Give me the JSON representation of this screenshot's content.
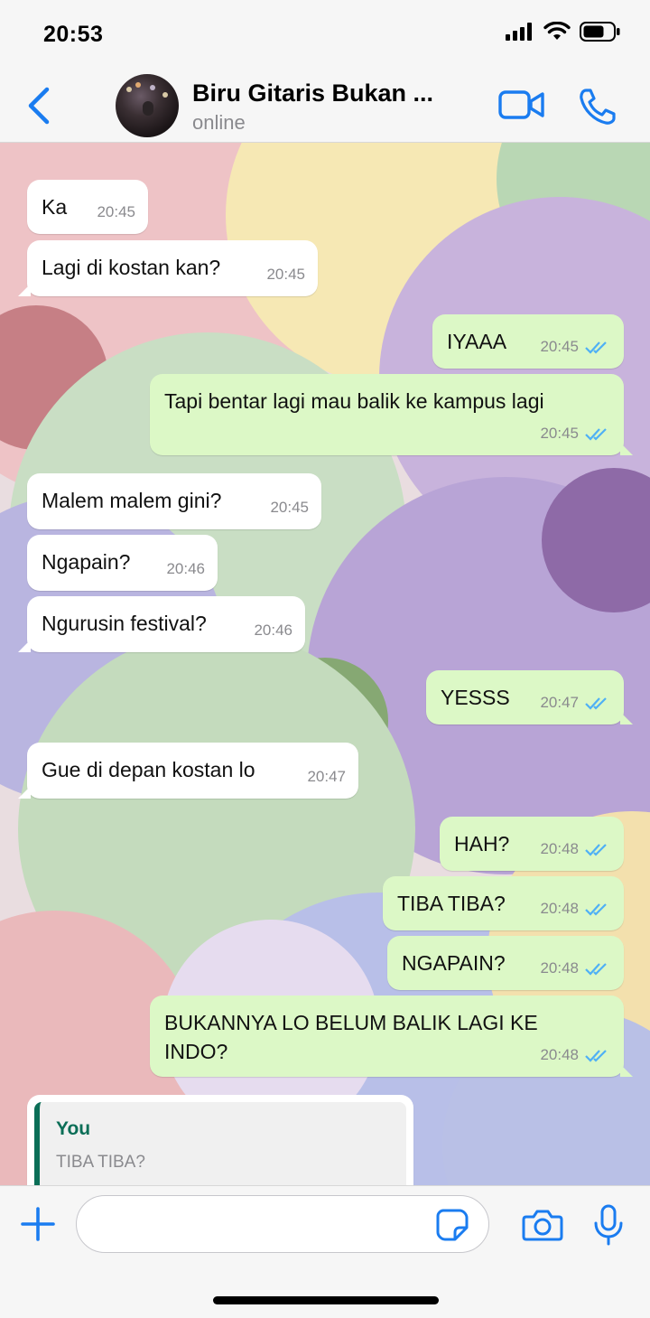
{
  "status_bar": {
    "time": "20:53"
  },
  "header": {
    "contact_name": "Biru Gitaris Bukan ...",
    "status": "online"
  },
  "messages": [
    {
      "dir": "in",
      "text": "Ka",
      "time": "20:45"
    },
    {
      "dir": "in",
      "text": "Lagi di kostan kan?",
      "time": "20:45"
    },
    {
      "dir": "out",
      "text": "IYAAA",
      "time": "20:45"
    },
    {
      "dir": "out",
      "text": "Tapi bentar lagi mau balik ke kampus lagi",
      "time": "20:45"
    },
    {
      "dir": "in",
      "text": "Malem malem gini?",
      "time": "20:45"
    },
    {
      "dir": "in",
      "text": "Ngapain?",
      "time": "20:46"
    },
    {
      "dir": "in",
      "text": "Ngurusin festival?",
      "time": "20:46"
    },
    {
      "dir": "out",
      "text": "YESSS",
      "time": "20:47"
    },
    {
      "dir": "in",
      "text": "Gue di depan kostan lo",
      "time": "20:47"
    },
    {
      "dir": "out",
      "text": "HAH?",
      "time": "20:48"
    },
    {
      "dir": "out",
      "text": "TIBA TIBA?",
      "time": "20:48"
    },
    {
      "dir": "out",
      "text": "NGAPAIN?",
      "time": "20:48"
    },
    {
      "dir": "out",
      "text": "BUKANNYA LO BELUM BALIK LAGI KE",
      "text2": "INDO?",
      "time": "20:48"
    }
  ],
  "reply_preview": {
    "author": "You",
    "text": "TIBA TIBA?"
  },
  "colors": {
    "accent": "#1a7cf0",
    "out_bubble": "#dcf8c6",
    "in_bubble": "#ffffff",
    "read_ticks": "#4fb0f5",
    "quote_bar": "#0b6e57"
  }
}
